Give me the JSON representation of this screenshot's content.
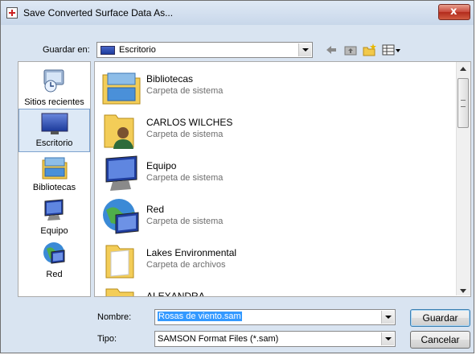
{
  "window": {
    "title": "Save Converted Surface Data As...",
    "close_label": "x"
  },
  "toolbar": {
    "save_in_label": "Guardar en:",
    "location": "Escritorio",
    "icons": [
      "back-arrow-icon",
      "up-folder-icon",
      "new-folder-icon",
      "view-menu-icon"
    ]
  },
  "places": [
    {
      "label": "Sitios recientes",
      "icon": "recent-places-icon"
    },
    {
      "label": "Escritorio",
      "icon": "desktop-icon",
      "selected": true
    },
    {
      "label": "Bibliotecas",
      "icon": "libraries-icon"
    },
    {
      "label": "Equipo",
      "icon": "computer-icon"
    },
    {
      "label": "Red",
      "icon": "network-icon"
    }
  ],
  "files": [
    {
      "name": "Bibliotecas",
      "type": "Carpeta de sistema",
      "icon": "libraries-icon"
    },
    {
      "name": "CARLOS WILCHES",
      "type": "Carpeta de sistema",
      "icon": "user-folder-icon"
    },
    {
      "name": "Equipo",
      "type": "Carpeta de sistema",
      "icon": "computer-icon"
    },
    {
      "name": "Red",
      "type": "Carpeta de sistema",
      "icon": "network-icon"
    },
    {
      "name": "Lakes Environmental",
      "type": "Carpeta de archivos",
      "icon": "folder-icon"
    },
    {
      "name": "ALEXANDRA",
      "type": "",
      "icon": "folder-icon"
    }
  ],
  "form": {
    "filename_label": "Nombre:",
    "filename_value": "Rosas de viento.sam",
    "type_label": "Tipo:",
    "type_value": "SAMSON Format Files (*.sam)"
  },
  "buttons": {
    "save": "Guardar",
    "cancel": "Cancelar"
  },
  "colors": {
    "selection": "#3399ff",
    "window_bg": "#d9e4f1",
    "close_button": "#c8473a"
  }
}
